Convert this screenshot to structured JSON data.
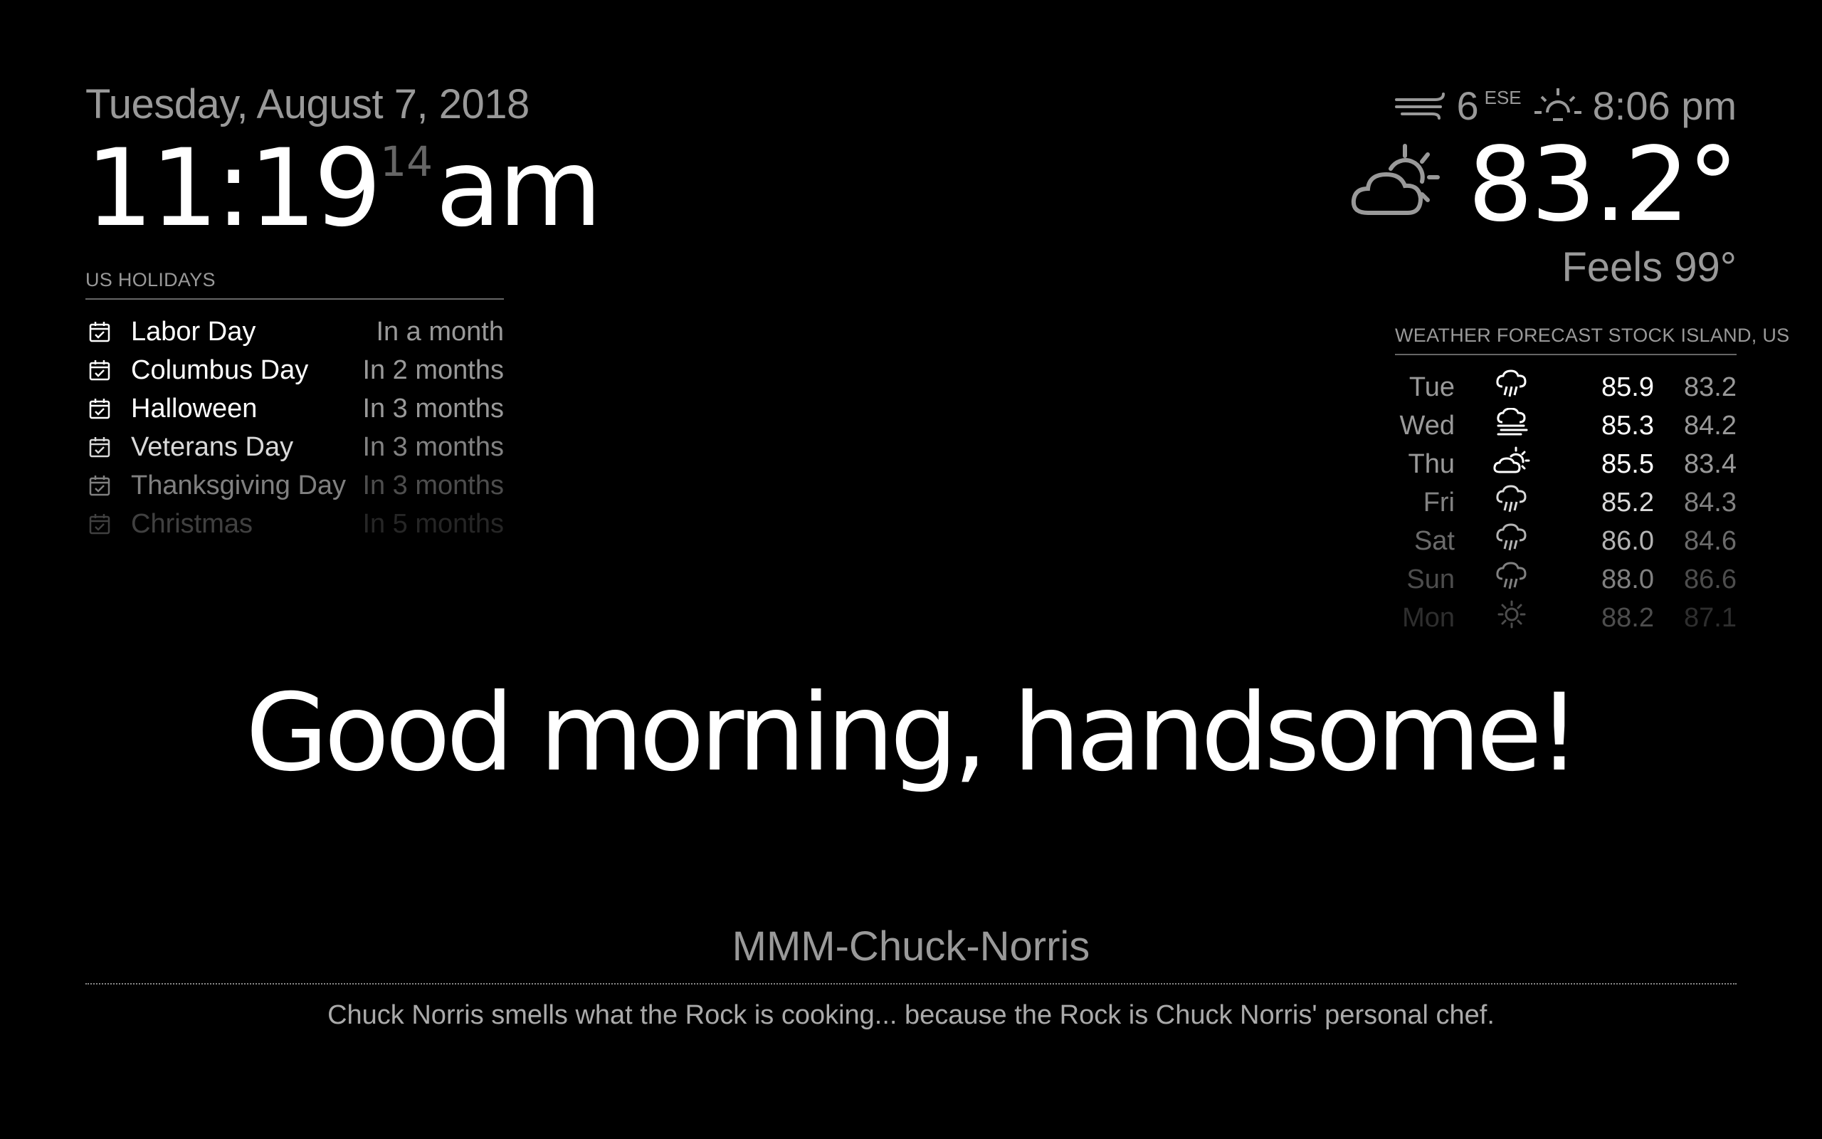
{
  "clock": {
    "date": "Tuesday, August 7, 2018",
    "hours_minutes": "11:19",
    "seconds": "14",
    "period": "am"
  },
  "holidays": {
    "header": "US HOLIDAYS",
    "items": [
      {
        "name": "Labor Day",
        "when": "In a month",
        "icon": "calendar-check-icon"
      },
      {
        "name": "Columbus Day",
        "when": "In 2 months",
        "icon": "calendar-check-icon"
      },
      {
        "name": "Halloween",
        "when": "In 3 months",
        "icon": "calendar-check-icon"
      },
      {
        "name": "Veterans Day",
        "when": "In 3 months",
        "icon": "calendar-check-icon"
      },
      {
        "name": "Thanksgiving Day",
        "when": "In 3 months",
        "icon": "calendar-check-icon"
      },
      {
        "name": "Christmas",
        "when": "In 5 months",
        "icon": "calendar-check-icon"
      }
    ]
  },
  "current_weather": {
    "wind_speed": "6",
    "wind_direction": "ESE",
    "sunset_time": "8:06 pm",
    "temperature": "83.2°",
    "feels_like": "Feels 99°",
    "icon": "partly-cloudy-day-icon"
  },
  "forecast": {
    "header": "WEATHER FORECAST STOCK ISLAND, US",
    "days": [
      {
        "day": "Tue",
        "max": "85.9",
        "min": "83.2",
        "icon": "rain-icon"
      },
      {
        "day": "Wed",
        "max": "85.3",
        "min": "84.2",
        "icon": "fog-icon"
      },
      {
        "day": "Thu",
        "max": "85.5",
        "min": "83.4",
        "icon": "partly-cloudy-icon"
      },
      {
        "day": "Fri",
        "max": "85.2",
        "min": "84.3",
        "icon": "rain-icon"
      },
      {
        "day": "Sat",
        "max": "86.0",
        "min": "84.6",
        "icon": "rain-icon"
      },
      {
        "day": "Sun",
        "max": "88.0",
        "min": "86.6",
        "icon": "rain-icon"
      },
      {
        "day": "Mon",
        "max": "88.2",
        "min": "87.1",
        "icon": "sunny-icon"
      }
    ]
  },
  "greeting": "Good morning, handsome!",
  "chuck_norris": {
    "title": "MMM-Chuck-Norris",
    "joke": "Chuck Norris smells what the Rock is cooking... because the Rock is Chuck Norris' personal chef."
  }
}
